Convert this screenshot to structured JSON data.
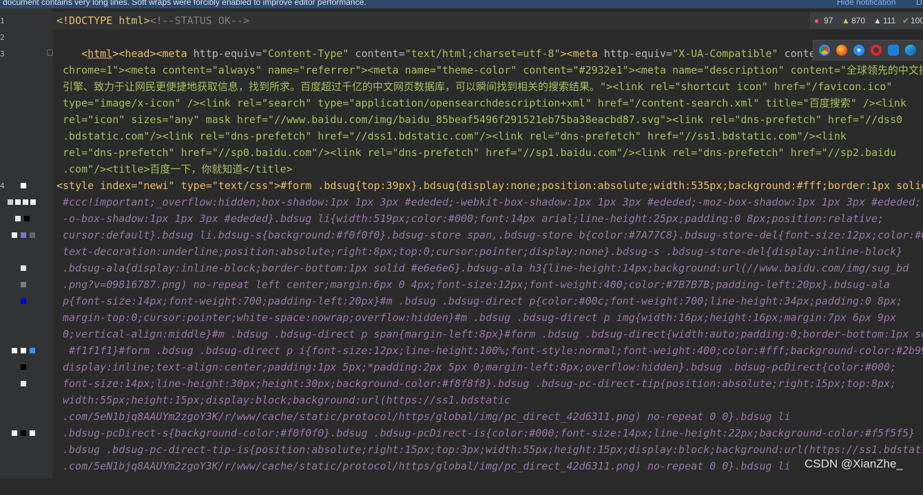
{
  "notification": {
    "message": "document contains very long lines. Soft wraps were forcibly enabled to improve editor performance.",
    "hide_label": "Hide notification",
    "extra_label": "D"
  },
  "status": {
    "errors": "97",
    "warnings": "870",
    "weak": "111",
    "ok": "100"
  },
  "gutter": {
    "line_numbers": [
      "1",
      "2",
      "3",
      "4"
    ]
  },
  "watermark": "CSDN @XianZhe_",
  "code": {
    "l1_a": "<!DOCTYPE ",
    "l1_b": "html",
    "l1_c": ">",
    "l1_d": "<!--STATUS OK-->",
    "l3": [
      "<",
      "html",
      "><",
      "head",
      "><",
      "meta ",
      "http-equiv",
      "=",
      "\"Content-Type\"",
      " content",
      "=",
      "\"text/html;charset=utf-8\"",
      "><",
      "meta ",
      "http-equiv",
      "=",
      "\"X-UA-Compatible\"",
      " conte"
    ],
    "l4": "chrome=1\"><meta content=\"always\" name=\"referrer\"><meta name=\"theme-color\" content=\"#2932e1\"><meta name=\"description\" content=\"全球领先的中文搜",
    "l5": "引擎、致力于让网民更便捷地获取信息，找到所求。百度超过千亿的中文网页数据库，可以瞬间找到相关的搜索结果。\"><link rel=\"shortcut icon\" href=\"/favicon.ico\"",
    "l6": "type=\"image/x-icon\" /><link rel=\"search\" type=\"application/opensearchdescription+xml\" href=\"/content-search.xml\" title=\"百度搜索\" /><link",
    "l7": "rel=\"icon\" sizes=\"any\" mask href=\"//www.baidu.com/img/baidu_85beaf5496f291521eb75ba38eacbd87.svg\"><link rel=\"dns-prefetch\" href=\"//dss0",
    "l8": ".bdstatic.com\"/><link rel=\"dns-prefetch\" href=\"//dss1.bdstatic.com\"/><link rel=\"dns-prefetch\" href=\"//ss1.bdstatic.com\"/><link",
    "l9": "rel=\"dns-prefetch\" href=\"//sp0.baidu.com\"/><link rel=\"dns-prefetch\" href=\"//sp1.baidu.com\"/><link rel=\"dns-prefetch\" href=\"//sp2.baidu",
    "l10": ".com\"/><title>百度一下，你就知道</title>",
    "l11": "<style index=\"newi\" type=\"text/css\">#form .bdsug{top:39px}.bdsug{display:none;position:absolute;width:535px;background:#fff;border:1px solid",
    "l12": "#ccc!important;_overflow:hidden;box-shadow:1px 1px 3px #ededed;-webkit-box-shadow:1px 1px 3px #ededed;-moz-box-shadow:1px 1px 3px #ededed;",
    "l13": "-o-box-shadow:1px 1px 3px #ededed}.bdsug li{width:519px;color:#000;font:14px arial;line-height:25px;padding:0 8px;position:relative;",
    "l14": "cursor:default}.bdsug li.bdsug-s{background:#f0f0f0}.bdsug-store span,.bdsug-store b{color:#7A77C8}.bdsug-store-del{font-size:12px;color:#6",
    "l15": "text-decoration:underline;position:absolute;right:8px;top:0;cursor:pointer;display:none}.bdsug-s .bdsug-store-del{display:inline-block}",
    "l16": ".bdsug-ala{display:inline-block;border-bottom:1px solid #e6e6e6}.bdsug-ala h3{line-height:14px;background:url(//www.baidu.com/img/sug_bd",
    "l17": ".png?v=09816787.png) no-repeat left center;margin:6px 0 4px;font-size:12px;font-weight:400;color:#7B7B7B;padding-left:20px}.bdsug-ala",
    "l18": "p{font-size:14px;font-weight:700;padding-left:20px}#m .bdsug .bdsug-direct p{color:#00c;font-weight:700;line-height:34px;padding:0 8px;",
    "l19": "margin-top:0;cursor:pointer;white-space:nowrap;overflow:hidden}#m .bdsug .bdsug-direct p img{width:16px;height:16px;margin:7px 6px 9px",
    "l20": "0;vertical-align:middle}#m .bdsug .bdsug-direct p span{margin-left:8px}#form .bdsug .bdsug-direct{width:auto;padding:0;border-bottom:1px so",
    "l21": " #f1f1f1}#form .bdsug .bdsug-direct p i{font-size:12px;line-height:100%;font-style:normal;font-weight:400;color:#fff;background-color:#2b99",
    "l22": "display:inline;text-align:center;padding:1px 5px;*padding:2px 5px 0;margin-left:8px;overflow:hidden}.bdsug .bdsug-pcDirect{color:#000;",
    "l23": "font-size:14px;line-height:30px;height:30px;background-color:#f8f8f8}.bdsug .bdsug-pc-direct-tip{position:absolute;right:15px;top:8px;",
    "l24": "width:55px;height:15px;display:block;background:url(https://ss1.bdstatic",
    "l25": ".com/5eN1bjq8AAUYm2zgoY3K/r/www/cache/static/protocol/https/global/img/pc_direct_42d6311.png) no-repeat 0 0}.bdsug li",
    "l26": ".bdsug-pcDirect-s{background-color:#f0f0f0}.bdsug .bdsug-pcDirect-is{color:#000;font-size:14px;line-height:22px;background-color:#f5f5f5}",
    "l27": ".bdsug .bdsug-pc-direct-tip-is{position:absolute;right:15px;top:3px;width:55px;height:15px;display:block;background:url(https://ss1.bdstati",
    "l28": ".com/5eN1bjq8AAUYm2zgoY3K/r/www/cache/static/protocol/https/global/img/pc_direct_42d6311.png) no-repeat 0 0}.bdsug li"
  }
}
